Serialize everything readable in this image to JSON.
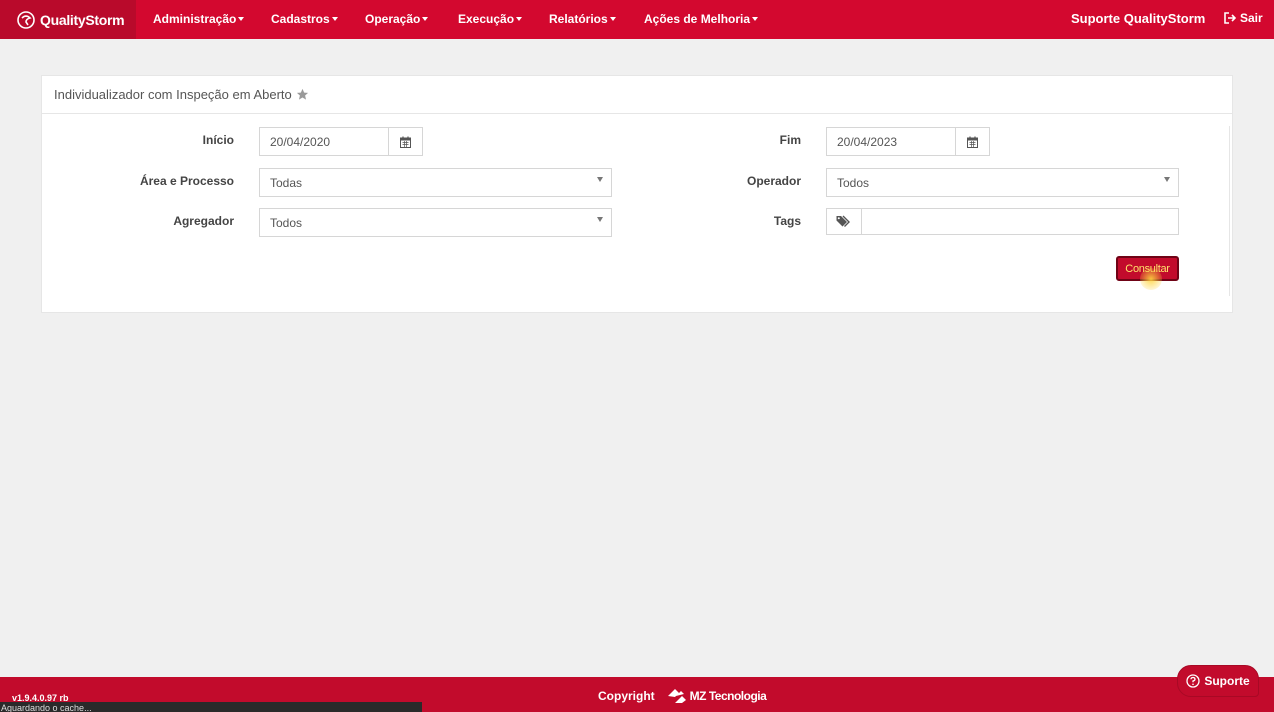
{
  "nav": {
    "brand": "QualityStorm",
    "items": [
      "Administração",
      "Cadastros",
      "Operação",
      "Execução",
      "Relatórios",
      "Ações de Melhoria"
    ],
    "support": "Suporte QualityStorm",
    "logout": "Sair"
  },
  "panel": {
    "title": "Individualizador com Inspeção em Aberto",
    "inicio_label": "Início",
    "inicio_value": "20/04/2020",
    "fim_label": "Fim",
    "fim_value": "20/04/2023",
    "area_label": "Área e Processo",
    "area_value": "Todas",
    "operador_label": "Operador",
    "operador_value": "Todos",
    "agregador_label": "Agregador",
    "agregador_value": "Todos",
    "tags_label": "Tags",
    "tags_value": "",
    "consultar": "Consultar"
  },
  "footer": {
    "version": "v1.9.4.0.97 rb",
    "status": "Aguardando o cache...",
    "copyright": "Copyright",
    "company": "MZ Tecnologia",
    "support_button": "Suporte"
  },
  "colors": {
    "primary": "#d3082f",
    "footer": "#c20b2c",
    "background": "#f0f0f0"
  }
}
